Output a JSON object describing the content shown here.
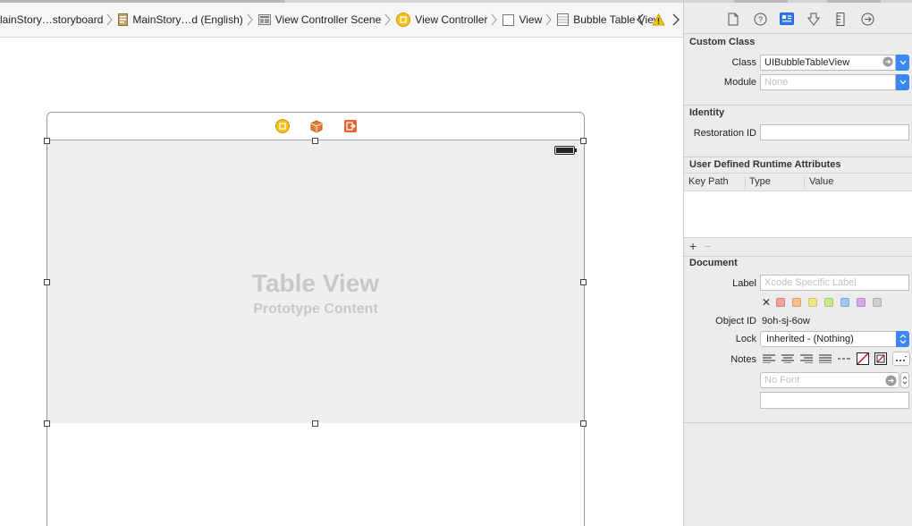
{
  "breadcrumbs": [
    {
      "label": "lainStory…storyboard",
      "icon": "storyboard-file-icon"
    },
    {
      "label": "MainStory…d (English)",
      "icon": "storyboard-file-icon"
    },
    {
      "label": "View Controller Scene",
      "icon": "scene-icon"
    },
    {
      "label": "View Controller",
      "icon": "view-controller-icon"
    },
    {
      "label": "View",
      "icon": "view-icon"
    },
    {
      "label": "Bubble Table View",
      "icon": "table-view-icon"
    }
  ],
  "canvas": {
    "tableview_title": "Table View",
    "tableview_subtitle": "Prototype Content"
  },
  "inspector": {
    "tabs": [
      "file-inspector-icon",
      "quick-help-icon",
      "identity-inspector-icon",
      "attributes-inspector-icon",
      "size-inspector-icon",
      "connections-inspector-icon"
    ],
    "custom_class": {
      "title": "Custom Class",
      "class_label": "Class",
      "class_value": "UIBubbleTableView",
      "module_label": "Module",
      "module_placeholder": "None"
    },
    "identity": {
      "title": "Identity",
      "restoration_label": "Restoration ID",
      "restoration_value": ""
    },
    "runtime_attrs": {
      "title": "User Defined Runtime Attributes",
      "columns": [
        "Key Path",
        "Type",
        "Value"
      ],
      "add": "+",
      "remove": "−"
    },
    "document": {
      "title": "Document",
      "label_label": "Label",
      "label_placeholder": "Xcode Specific Label",
      "clear": "✕",
      "colors": [
        "#f5a09a",
        "#f7c08a",
        "#f3e38a",
        "#c9e88d",
        "#9ec9f2",
        "#d6a9ec",
        "#cfcfcf"
      ],
      "object_id_label": "Object ID",
      "object_id_value": "9oh-sj-6ow",
      "lock_label": "Lock",
      "lock_value": "Inherited - (Nothing)",
      "notes_label": "Notes",
      "font_placeholder": "No Font"
    }
  }
}
